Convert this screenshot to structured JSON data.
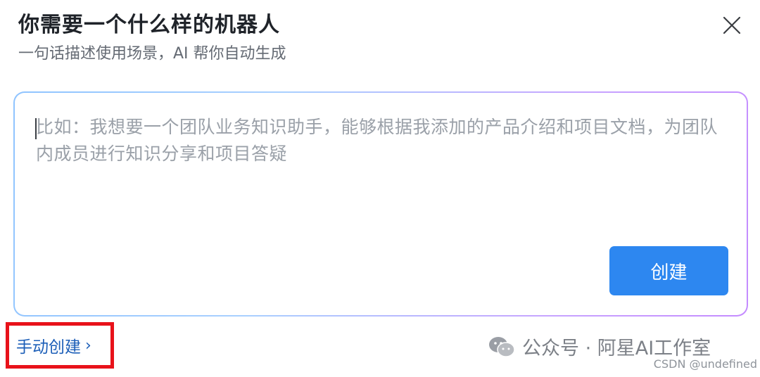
{
  "dialog": {
    "title": "你需要一个什么样的机器人",
    "subtitle": "一句话描述使用场景，AI 帮你自动生成",
    "close_icon": "close-icon"
  },
  "prompt_input": {
    "value": "",
    "placeholder": "比如：我想要一个团队业务知识助手，能够根据我添加的产品介绍和项目文档，为团队内成员进行知识分享和项目答疑"
  },
  "create_button": {
    "label": "创建",
    "color": "#2d87f0"
  },
  "manual_create_link": {
    "label": "手动创建",
    "chevron": "›",
    "highlight_color": "#e8121a"
  },
  "watermark": {
    "icon": "wechat-icon",
    "text": "公众号 · 阿星AI工作室",
    "credit": "CSDN @undefined"
  }
}
